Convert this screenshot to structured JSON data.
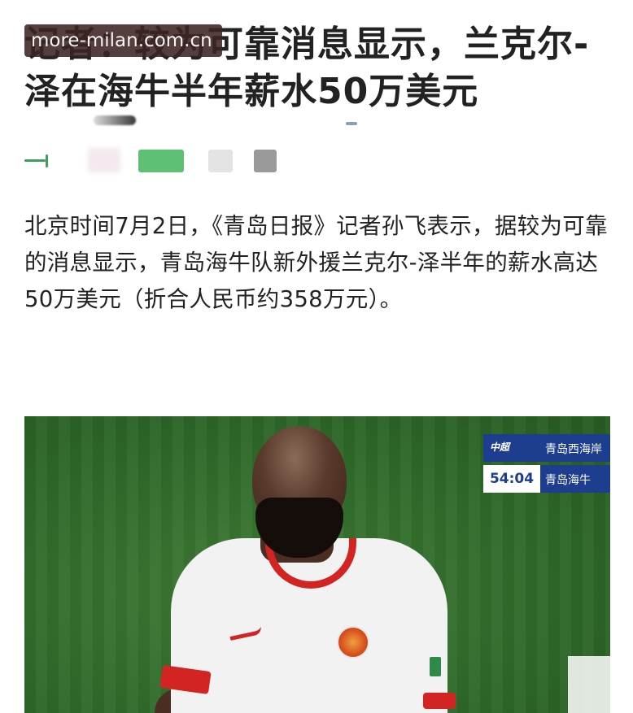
{
  "article": {
    "headline": "记者：较为可靠消息显示，兰克尔-泽在海牛半年薪水50万美元",
    "watermark": "more-milan.com.cn",
    "body": "北京时间7月2日，《青岛日报》记者孙飞表示，据较为可靠的消息显示，青岛海牛队新外援兰克尔-泽半年的薪水高达50万美元（折合人民币约358万元）。"
  },
  "photo": {
    "scoreboard": {
      "logo": "中超",
      "team_top": "青岛西海岸",
      "match_time": "54:04",
      "team_bottom": "青岛海牛"
    }
  },
  "colors": {
    "scoreboard_blue": "#1d3d8f",
    "jersey_red": "#d32424",
    "pitch_green": "#2f6a2a"
  }
}
